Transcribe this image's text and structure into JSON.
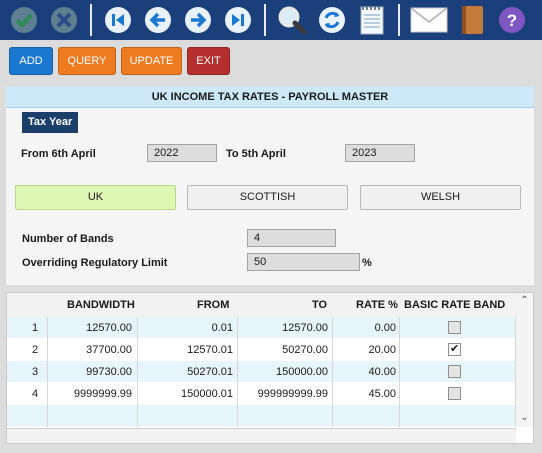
{
  "toolbar": {
    "icons": [
      "check-icon",
      "cancel-icon",
      "first-record-icon",
      "previous-icon",
      "next-icon",
      "last-record-icon",
      "search-icon",
      "refresh-icon",
      "notepad-icon",
      "mail-icon",
      "book-icon",
      "help-icon"
    ],
    "help_glyph": "?"
  },
  "actions": {
    "add": "ADD",
    "query": "QUERY",
    "update": "UPDATE",
    "exit": "EXIT"
  },
  "panel": {
    "title": "UK INCOME TAX RATES - PAYROLL MASTER",
    "section": "Tax Year",
    "from_label": "From 6th April",
    "from_value": "2022",
    "to_label": "To 5th April",
    "to_value": "2023",
    "tabs": [
      "UK",
      "SCOTTISH",
      "WELSH"
    ],
    "active_tab": "UK",
    "bands_label": "Number of Bands",
    "bands_value": "4",
    "limit_label": "Overriding Regulatory Limit",
    "limit_value": "50",
    "limit_unit": "%"
  },
  "grid": {
    "headers": {
      "bandwidth": "BANDWIDTH",
      "from": "FROM",
      "to": "TO",
      "rate": "RATE %",
      "basic": "BASIC RATE BAND"
    },
    "rows": [
      {
        "n": "1",
        "bandwidth": "12570.00",
        "from": "0.01",
        "to": "12570.00",
        "rate": "0.00",
        "basic": false
      },
      {
        "n": "2",
        "bandwidth": "37700.00",
        "from": "12570.01",
        "to": "50270.00",
        "rate": "20.00",
        "basic": true
      },
      {
        "n": "3",
        "bandwidth": "99730.00",
        "from": "50270.01",
        "to": "150000.00",
        "rate": "40.00",
        "basic": false
      },
      {
        "n": "4",
        "bandwidth": "9999999.99",
        "from": "150000.01",
        "to": "999999999.99",
        "rate": "45.00",
        "basic": false
      }
    ]
  },
  "colors": {
    "toolbar": "#1b3f7a",
    "add": "#1b78d0",
    "orange": "#ee7b1f",
    "exit": "#b52f2f",
    "active_tab": "#dff7b4",
    "header_band": "#cde9f9"
  }
}
